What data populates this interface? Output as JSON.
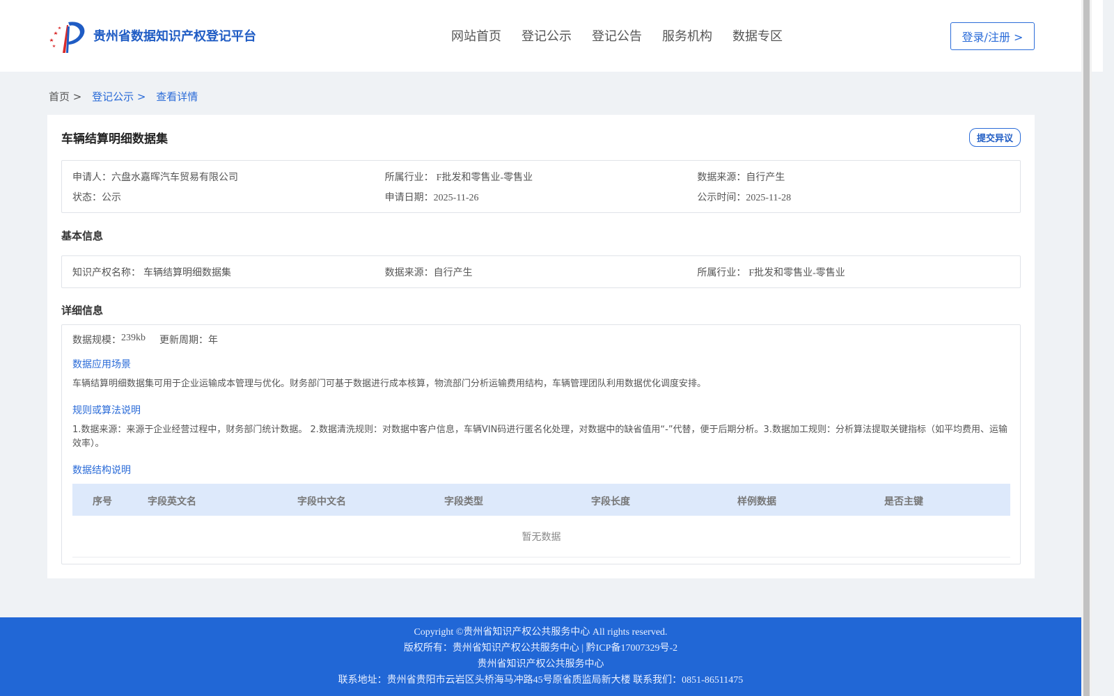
{
  "header": {
    "logo_text": "贵州省数据知识产权登记平台",
    "nav": [
      "网站首页",
      "登记公示",
      "登记公告",
      "服务机构",
      "数据专区"
    ],
    "login_label": "登录/注册 >"
  },
  "breadcrumb": {
    "home": "首页 >",
    "list": "登记公示 >",
    "current": "查看详情"
  },
  "detail": {
    "title": "车辆结算明细数据集",
    "objection_label": "提交异议",
    "summary": {
      "applicant_label": "申请人：",
      "applicant": "六盘水嘉晖汽车贸易有限公司",
      "industry_label": "所属行业：",
      "industry": "F批发和零售业-零售业",
      "source_label": "数据来源：",
      "source": "自行产生",
      "status_label": "状态：",
      "status": "公示",
      "apply_date_label": "申请日期：",
      "apply_date": "2025-11-26",
      "publish_label": "公示时间：",
      "publish_date": "2025-11-28"
    },
    "basic_heading": "基本信息",
    "basic": {
      "ip_name_label": "知识产权名称：",
      "ip_name": "车辆结算明细数据集",
      "source_label": "数据来源：",
      "source": "自行产生",
      "industry_label": "所属行业：",
      "industry": "F批发和零售业-零售业"
    },
    "detail_heading": "详细信息",
    "scale_label": "数据规模：",
    "scale": "239kb",
    "cycle_label": "更新周期：",
    "cycle": "年",
    "scene_heading": "数据应用场景",
    "scene_text": "车辆结算明细数据集可用于企业运输成本管理与优化。财务部门可基于数据进行成本核算，物流部门分析运输费用结构，车辆管理团队利用数据优化调度安排。",
    "rules_heading": "规则或算法说明",
    "rules_text": "1.数据来源：来源于企业经营过程中，财务部门统计数据。 2.数据清洗规则：对数据中客户信息，车辆VIN码进行匿名化处理，对数据中的缺省值用“-”代替，便于后期分析。3.数据加工规则：分析算法提取关键指标（如平均费用、运输效率）。",
    "structure_heading": "数据结构说明",
    "table_headers": [
      "序号",
      "字段英文名",
      "字段中文名",
      "字段类型",
      "字段长度",
      "样例数据",
      "是否主键"
    ],
    "empty_text": "暂无数据"
  },
  "footer": {
    "line1": "Copyright ©贵州省知识产权公共服务中心 All rights reserved.",
    "line2": "版权所有：贵州省知识产权公共服务中心 | 黔ICP备17007329号-2",
    "line3": "贵州省知识产权公共服务中心",
    "line4": "联系地址：贵州省贵阳市云岩区头桥海马冲路45号原省质监局新大楼 联系我们：0851-86511475"
  },
  "colors": {
    "brand": "#1f5cc4",
    "link": "#2a6bd8",
    "footer_bg": "#2167d6",
    "table_header_bg": "#dde9fb"
  }
}
